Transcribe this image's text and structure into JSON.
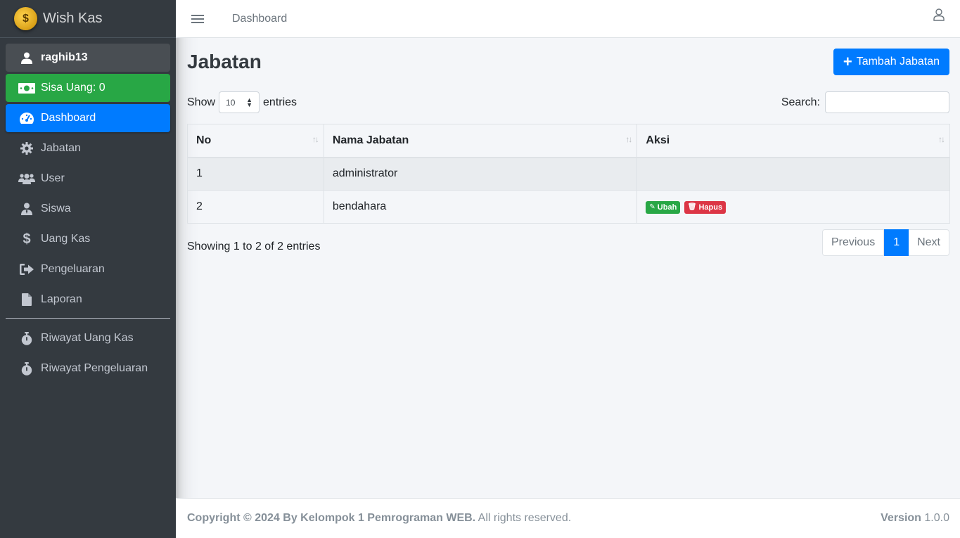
{
  "brand": {
    "name": "Wish Kas",
    "logo_symbol": "$"
  },
  "sidebar": {
    "user": "raghib13",
    "balance": "Sisa Uang: 0",
    "items": [
      {
        "label": "Dashboard",
        "icon": "tachometer-icon"
      },
      {
        "label": "Jabatan",
        "icon": "gear-icon"
      },
      {
        "label": "User",
        "icon": "users-icon"
      },
      {
        "label": "Siswa",
        "icon": "user-tie-icon"
      },
      {
        "label": "Uang Kas",
        "icon": "dollar-icon"
      },
      {
        "label": "Pengeluaran",
        "icon": "sign-out-icon"
      },
      {
        "label": "Laporan",
        "icon": "file-icon"
      }
    ],
    "history": [
      {
        "label": "Riwayat Uang Kas",
        "icon": "stopwatch-icon"
      },
      {
        "label": "Riwayat Pengeluaran",
        "icon": "stopwatch-icon"
      }
    ]
  },
  "topbar": {
    "link": "Dashboard"
  },
  "page": {
    "title": "Jabatan",
    "add_button": "Tambah Jabatan",
    "show_label": "Show",
    "entries_label": "entries",
    "page_size": "10",
    "search_label": "Search:",
    "search_value": ""
  },
  "table": {
    "headers": [
      "No",
      "Nama Jabatan",
      "Aksi"
    ],
    "rows": [
      {
        "no": "1",
        "nama": "administrator"
      },
      {
        "no": "2",
        "nama": "bendahara",
        "edit": "Ubah",
        "delete": "Hapus"
      }
    ]
  },
  "info": "Showing 1 to 2 of 2 entries",
  "pagination": {
    "prev": "Previous",
    "current": "1",
    "next": "Next"
  },
  "footer": {
    "copyright": "Copyright © 2024 By Kelompok 1 Pemrograman WEB.",
    "rights": "All rights reserved.",
    "version_label": "Version",
    "version": "1.0.0"
  },
  "colors": {
    "primary": "#007bff",
    "success": "#28a745",
    "danger": "#dc3545",
    "sidebar": "#343a40"
  }
}
